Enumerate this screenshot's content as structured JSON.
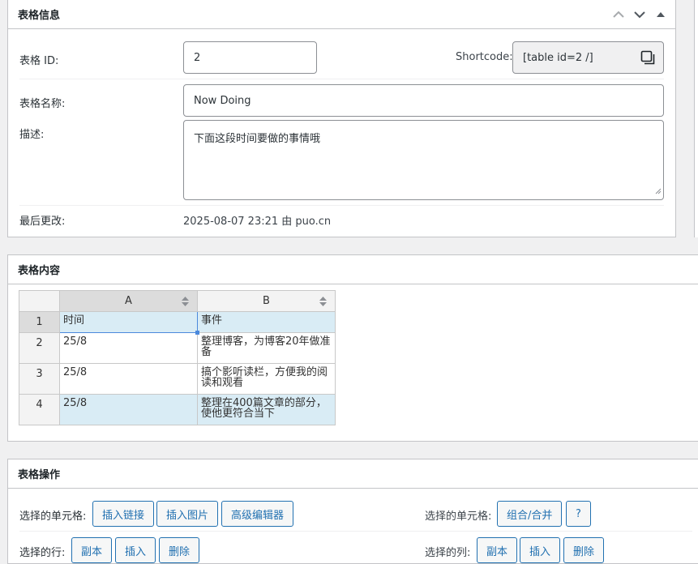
{
  "info_panel": {
    "title": "表格信息",
    "id_label": "表格 ID:",
    "id_value": "2",
    "shortcode_label": "Shortcode:",
    "shortcode_value": "[table id=2 /]",
    "name_label": "表格名称:",
    "name_value": "Now Doing",
    "desc_label": "描述:",
    "desc_value": "下面这段时间要做的事情哦",
    "modified_label": "最后更改:",
    "modified_value": "2025-08-07 23:21 由 puo.cn"
  },
  "content_panel": {
    "title": "表格内容",
    "columns": [
      "A",
      "B"
    ],
    "rows": [
      {
        "num": "1",
        "a": "时间",
        "b": "事件"
      },
      {
        "num": "2",
        "a": "25/8",
        "b": "整理博客，为博客20年做准备"
      },
      {
        "num": "3",
        "a": "25/8",
        "b": "搞个影听读栏，方便我的阅读和观看"
      },
      {
        "num": "4",
        "a": "25/8",
        "b": "整理在400篇文章的部分，使他更符合当下"
      }
    ]
  },
  "ops_panel": {
    "title": "表格操作",
    "cells_label": "选择的单元格:",
    "insert_link": "插入链接",
    "insert_image": "插入图片",
    "advanced_editor": "高级编辑器",
    "cells_label_2": "选择的单元格:",
    "merge": "组合/合并",
    "help": "?",
    "rows_label": "选择的行:",
    "row_copy": "副本",
    "row_insert": "插入",
    "row_delete": "删除",
    "cols_label": "选择的列:",
    "col_copy": "副本",
    "col_insert": "插入",
    "col_delete": "删除"
  }
}
